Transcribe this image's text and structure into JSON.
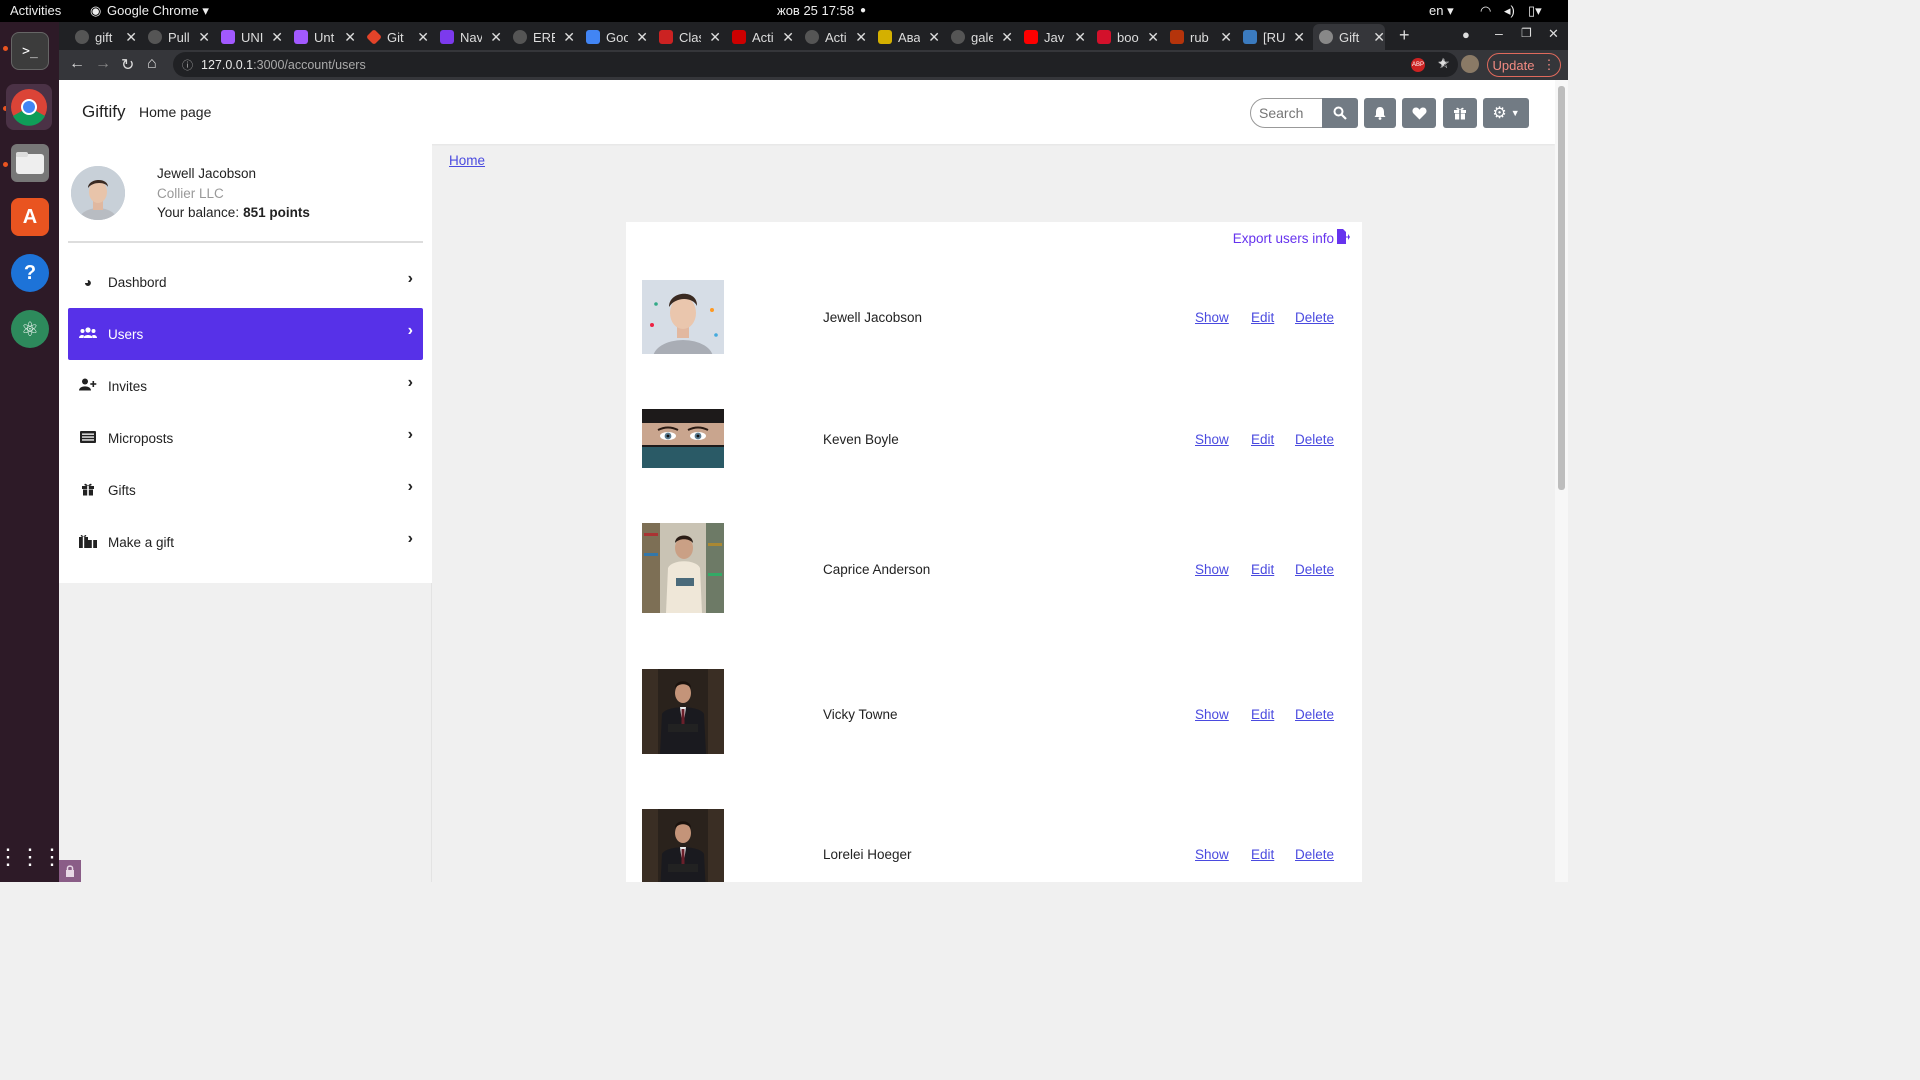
{
  "system": {
    "activities": "Activities",
    "app_menu": "Google Chrome ▾",
    "datetime": "жов 25  17:58",
    "lang": "en ▾"
  },
  "tabs": [
    {
      "title": "gift",
      "color": "#555"
    },
    {
      "title": "Pull",
      "color": "#555"
    },
    {
      "title": "UNI",
      "color": "#a259ff"
    },
    {
      "title": "Unt",
      "color": "#a259ff"
    },
    {
      "title": "Git",
      "color": "#e24329"
    },
    {
      "title": "Nav",
      "color": "#7c3aed"
    },
    {
      "title": "ERE",
      "color": "#555"
    },
    {
      "title": "Goo",
      "color": "#4285f4"
    },
    {
      "title": "Clas",
      "color": "#cc2222"
    },
    {
      "title": "Acti",
      "color": "#cc0000"
    },
    {
      "title": "Acti",
      "color": "#555"
    },
    {
      "title": "Ава",
      "color": "#d4b000"
    },
    {
      "title": "gale",
      "color": "#555"
    },
    {
      "title": "Jav",
      "color": "#ff0000"
    },
    {
      "title": "boo",
      "color": "#d3112b"
    },
    {
      "title": "rub",
      "color": "#b5340b"
    },
    {
      "title": "[RU",
      "color": "#3b7bbf"
    },
    {
      "title": "Gift",
      "color": "#888",
      "active": true
    }
  ],
  "browser": {
    "url_host": "127.0.0.1",
    "url_path": ":3000/account/users",
    "update_label": "Update"
  },
  "navbar": {
    "brand": "Giftify",
    "home_link": "Home page",
    "search_placeholder": "Search"
  },
  "profile": {
    "name": "Jewell Jacobson",
    "company": "Collier LLC",
    "balance_label": "Your balance:",
    "balance_value": "851 points"
  },
  "menu": [
    {
      "label": "Dashbord",
      "icon": "dashboard-icon",
      "active": false
    },
    {
      "label": "Users",
      "icon": "users-icon",
      "active": true
    },
    {
      "label": "Invites",
      "icon": "user-plus-icon",
      "active": false
    },
    {
      "label": "Microposts",
      "icon": "list-icon",
      "active": false
    },
    {
      "label": "Gifts",
      "icon": "gift-icon",
      "active": false
    },
    {
      "label": "Make a gift",
      "icon": "gifts-icon",
      "active": false
    }
  ],
  "breadcrumb": {
    "home": "Home"
  },
  "users_card": {
    "export_label": "Export users info",
    "show_label": "Show",
    "edit_label": "Edit",
    "delete_label": "Delete"
  },
  "users": [
    {
      "name": "Jewell Jacobson"
    },
    {
      "name": "Keven Boyle"
    },
    {
      "name": "Caprice Anderson"
    },
    {
      "name": "Vicky Towne"
    },
    {
      "name": "Lorelei Hoeger"
    }
  ],
  "colors": {
    "accent": "#5731e8",
    "link": "#4a4adf",
    "export": "#6633ee"
  }
}
